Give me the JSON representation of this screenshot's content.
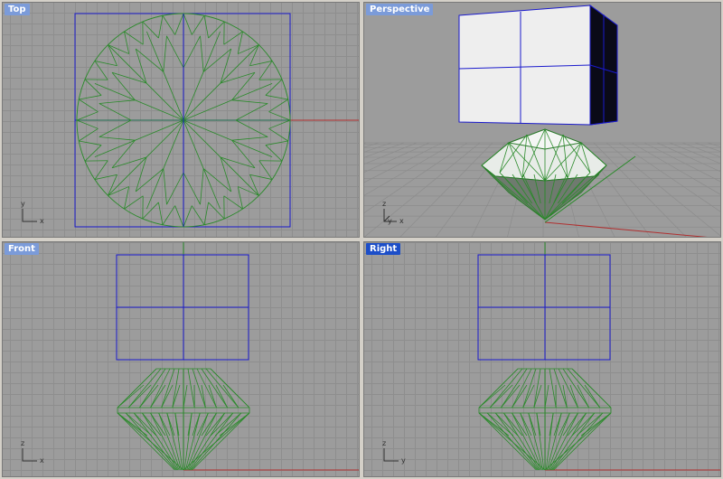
{
  "viewports": {
    "top": {
      "title": "Top",
      "axis_x": "x",
      "axis_y": "y"
    },
    "persp": {
      "title": "Perspective",
      "axis_x": "x",
      "axis_y": "y",
      "axis_z": "z"
    },
    "front": {
      "title": "Front",
      "axis_x": "x",
      "axis_z": "z"
    },
    "right": {
      "title": "Right",
      "axis_y": "y",
      "axis_z": "z"
    }
  },
  "colors": {
    "viewport_bg": "#9c9c9c",
    "grid_line": "#8e8e8e",
    "wire_green": "#2a8a2a",
    "wire_blue": "#1a1acc",
    "x_axis_red": "#b03030",
    "active_title": "#1c4ec8",
    "inactive_title": "#7b9bd9"
  },
  "active_viewport": "right"
}
